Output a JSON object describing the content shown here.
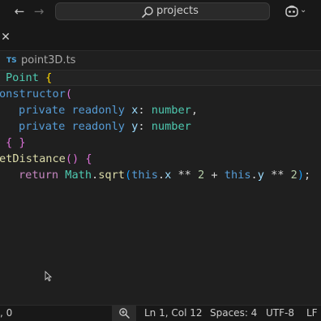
{
  "titlebar": {
    "back_icon": "arrow-left-icon",
    "forward_icon": "arrow-right-icon",
    "search_text": "projects",
    "search_icon": "search-icon",
    "copilot_icon": "copilot-icon",
    "chevron": "⌄"
  },
  "tabs": {
    "close_glyph": "✕"
  },
  "breadcrumb": {
    "lang_badge": "TS",
    "file": "point3D.ts"
  },
  "code": {
    "line1": {
      "name": "Point",
      "brace": "{"
    },
    "line2": {
      "keyword": "onstructor",
      "paren": "("
    },
    "line3": {
      "kw1": "private",
      "kw2": "readonly",
      "param": "x",
      "colon": ":",
      "type": "number",
      "comma": ","
    },
    "line4": {
      "kw1": "private",
      "kw2": "readonly",
      "param": "y",
      "colon": ":",
      "type": "number"
    },
    "line5": {
      "open": "{",
      "close": "}"
    },
    "line6": {
      "name": "etDistance",
      "parens": "()",
      "brace": "{"
    },
    "line7": {
      "ret": "return",
      "math": "Math",
      "dot": ".",
      "fn": "sqrt",
      "open": "(",
      "this1": "this",
      "dx": ".",
      "x": "x",
      "op1": " ** ",
      "n1": "2",
      "plus": " + ",
      "this2": "this",
      "dy": ".",
      "y": "y",
      "op2": " ** ",
      "n2": "2",
      "close": ")",
      "semi": ";"
    }
  },
  "statusbar": {
    "left": ", 0",
    "zoom_icon": "zoom-icon",
    "position": "Ln 1, Col 12",
    "spaces": "Spaces: 4",
    "encoding": "UTF-8",
    "eol": "LF"
  }
}
